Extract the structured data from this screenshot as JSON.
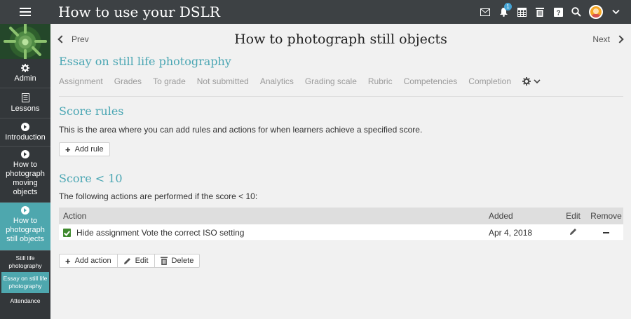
{
  "app": {
    "title": "How to use your DSLR",
    "notification_count": "1"
  },
  "sidebar": {
    "admin_label": "Admin",
    "lessons_label": "Lessons",
    "items": [
      {
        "label": "Introduction"
      },
      {
        "label": "How to photograph moving objects"
      },
      {
        "label": "How to photograph still objects"
      }
    ],
    "sub_items": [
      {
        "label": "Still life photography"
      },
      {
        "label": "Essay on still life photography"
      },
      {
        "label": "Attendance"
      }
    ]
  },
  "nav": {
    "prev_label": "Prev",
    "next_label": "Next"
  },
  "page": {
    "title": "How to photograph still objects",
    "subtitle": "Essay on still life photography"
  },
  "tabs": [
    "Assignment",
    "Grades",
    "To grade",
    "Not submitted",
    "Analytics",
    "Grading scale",
    "Rubric",
    "Competencies",
    "Completion"
  ],
  "score_rules": {
    "title": "Score rules",
    "description": "This is the area where you can add rules and actions for when learners achieve a specified score.",
    "add_rule_label": "Add rule"
  },
  "rule": {
    "title": "Score < 10",
    "description": "The following actions are performed if the score < 10:",
    "columns": {
      "action": "Action",
      "added": "Added",
      "edit": "Edit",
      "remove": "Remove"
    },
    "rows": [
      {
        "action": "Hide assignment Vote the correct ISO setting",
        "added": "Apr 4, 2018"
      }
    ],
    "buttons": {
      "add_action": "Add action",
      "edit": "Edit",
      "delete": "Delete"
    }
  },
  "colors": {
    "accent": "#4aa6b3",
    "topbar": "#3d4144",
    "sidebar": "#33373a",
    "selected": "#4ea7ae"
  }
}
